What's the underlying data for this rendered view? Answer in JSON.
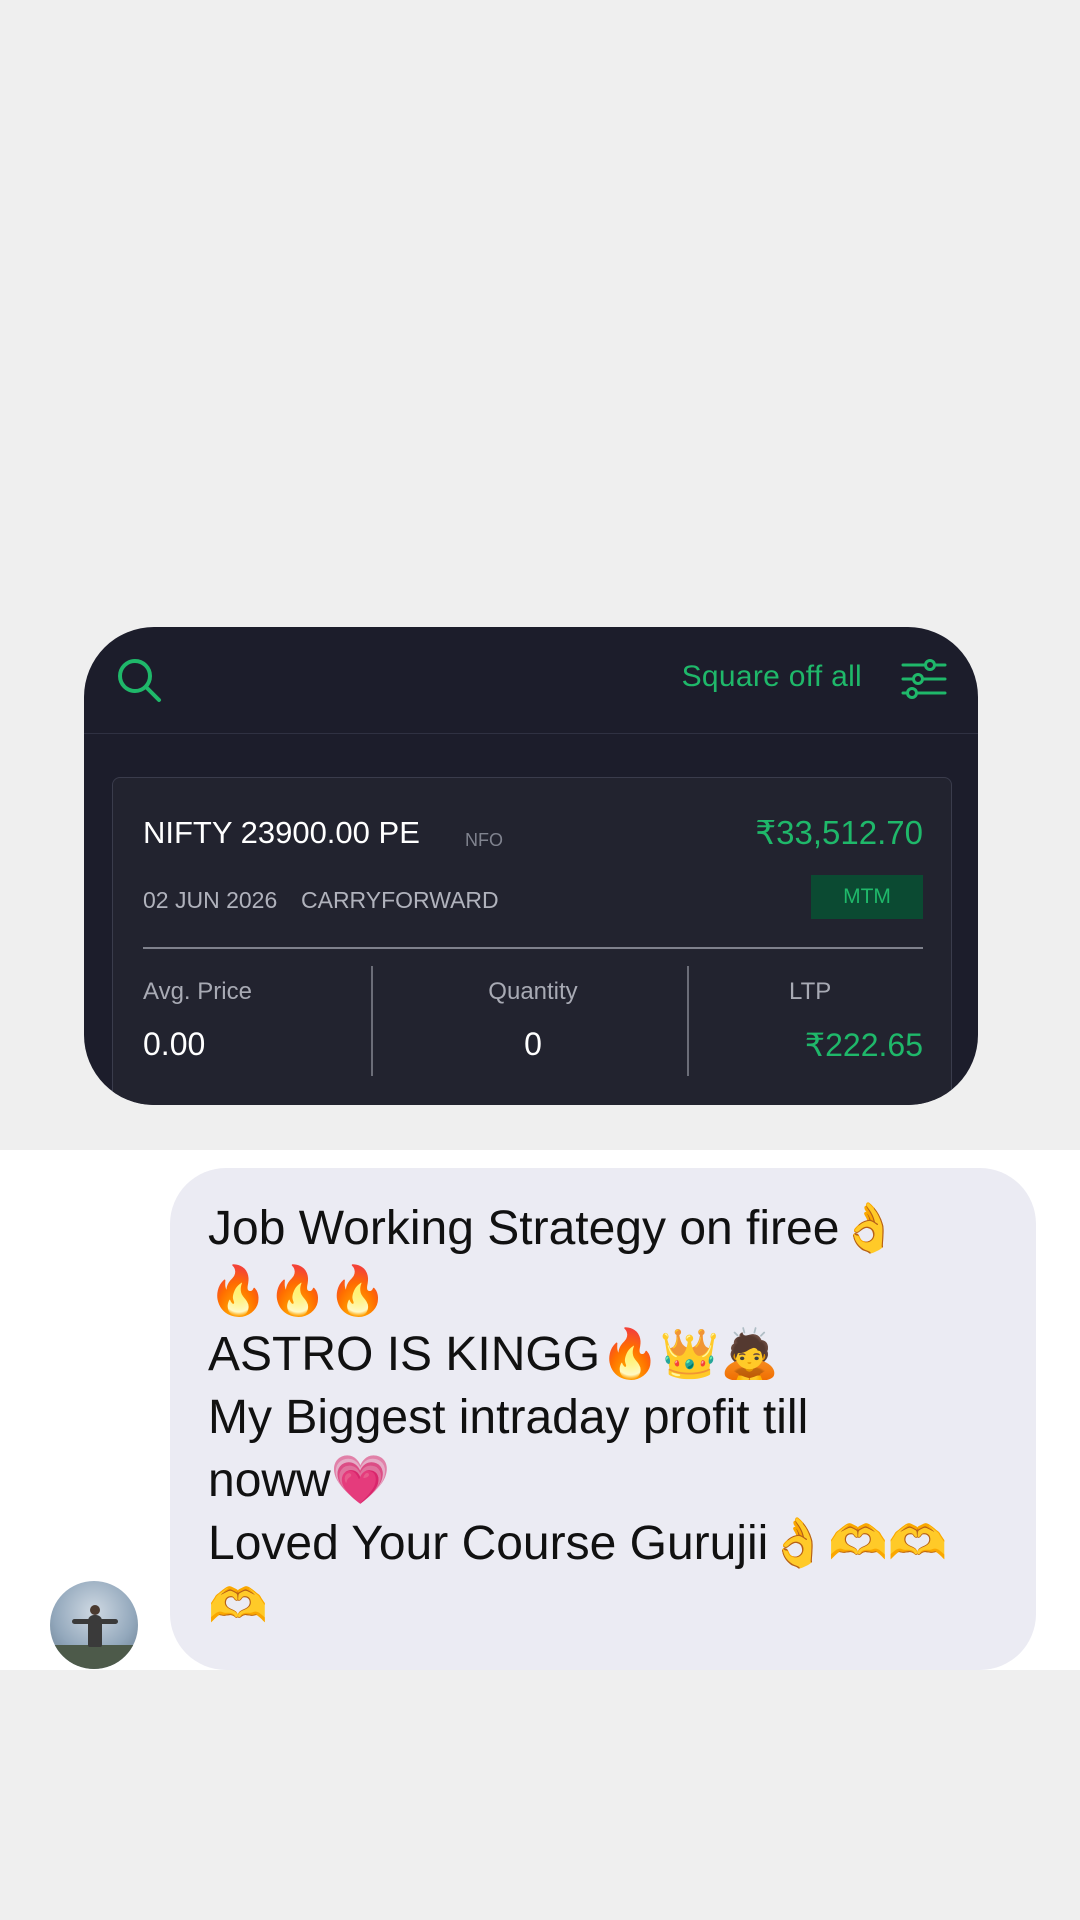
{
  "toolbar": {
    "search_icon": "search-icon",
    "square_off_label": "Square off all",
    "filter_icon": "filter-sliders-icon"
  },
  "position": {
    "symbol": "NIFTY 23900.00 PE",
    "exchange": "NFO",
    "pnl": "₹33,512.70",
    "expiry": "02 JUN 2026",
    "product": "CARRYFORWARD",
    "badge": "MTM",
    "avg_price_label": "Avg. Price",
    "avg_price_value": "0.00",
    "quantity_label": "Quantity",
    "quantity_value": "0",
    "ltp_label": "LTP",
    "ltp_value": "₹222.65"
  },
  "chat": {
    "message_lines": [
      "Job Working Strategy on firee👌",
      "🔥🔥🔥",
      "ASTRO IS KINGG🔥👑🙇",
      "My Biggest intraday profit till",
      "noww💗",
      "Loved Your Course Gurujii👌🫶🫶",
      "🫶"
    ]
  },
  "colors": {
    "accent_green": "#1fb86a",
    "card_bg": "#1c1d2b",
    "bubble_bg": "#ebebf3"
  }
}
